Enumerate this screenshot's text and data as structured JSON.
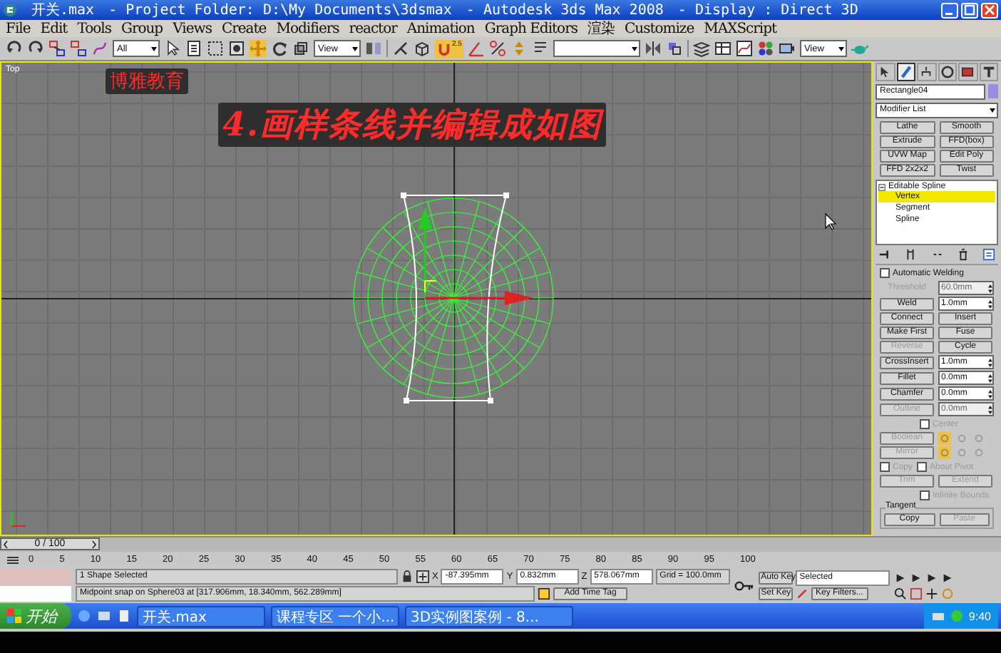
{
  "window": {
    "title_parts": [
      "开关.max",
      "- Project Folder: D:\\My Documents\\3dsmax",
      "- Autodesk 3ds Max 2008",
      "- Display : Direct 3D"
    ]
  },
  "menu": [
    "File",
    "Edit",
    "Tools",
    "Group",
    "Views",
    "Create",
    "Modifiers",
    "reactor",
    "Animation",
    "Graph Editors",
    "渲染",
    "Customize",
    "MAXScript"
  ],
  "toolbar": {
    "selection_filter": "All",
    "coord_system": "View",
    "snap_label": "2.5",
    "render_view": "View"
  },
  "viewport": {
    "label": "Top",
    "brand_caption": "博雅教育",
    "step_title": "4.画样条线并编辑成如图"
  },
  "command_panel": {
    "tabs": [
      {
        "selected": false
      },
      {
        "selected": true
      },
      {
        "selected": false
      },
      {
        "selected": false
      },
      {
        "selected": false
      },
      {
        "selected": false
      }
    ],
    "object_name": "Rectangle04",
    "modifier_list": "Modifier List",
    "modifier_buttons": [
      "Lathe",
      "Smooth",
      "Extrude",
      "FFD(box)",
      "UVW Map",
      "Edit Poly",
      "FFD 2x2x2",
      "Twist"
    ],
    "stack": [
      {
        "label": "Editable Spline",
        "expanded": true,
        "children": [
          {
            "label": "Vertex",
            "selected": true
          },
          {
            "label": "Segment",
            "selected": false
          },
          {
            "label": "Spline",
            "selected": false
          }
        ]
      }
    ],
    "rollout": [
      {
        "kind": "check",
        "label": "Automatic Welding",
        "checked": false,
        "disabled": false
      },
      {
        "kind": "spinner",
        "label": "Threshold",
        "value": "60.0mm",
        "button": false,
        "disabled": true
      },
      {
        "kind": "spinner",
        "label": "Weld",
        "value": "1.0mm",
        "button": true,
        "disabled": false
      },
      {
        "kind": "pair",
        "buttons": [
          {
            "label": "Connect",
            "disabled": false
          },
          {
            "label": "Insert",
            "disabled": false
          }
        ]
      },
      {
        "kind": "pair",
        "buttons": [
          {
            "label": "Make First",
            "disabled": false
          },
          {
            "label": "Fuse",
            "disabled": false
          }
        ]
      },
      {
        "kind": "pair",
        "buttons": [
          {
            "label": "Reverse",
            "disabled": true
          },
          {
            "label": "Cycle",
            "disabled": false
          }
        ]
      },
      {
        "kind": "spinner",
        "label": "CrossInsert",
        "value": "1.0mm",
        "button": true,
        "disabled": false
      },
      {
        "kind": "spinner",
        "label": "Fillet",
        "value": "0.0mm",
        "button": true,
        "disabled": false
      },
      {
        "kind": "spinner",
        "label": "Chamfer",
        "value": "0.0mm",
        "button": true,
        "disabled": false
      },
      {
        "kind": "spinner",
        "label": "Outline",
        "value": "0.0mm",
        "button": true,
        "disabled": true
      },
      {
        "kind": "check",
        "label": "Center",
        "checked": false,
        "disabled": true
      },
      {
        "kind": "tool",
        "label": "Boolean",
        "disabled": true
      },
      {
        "kind": "tool",
        "label": "Mirror",
        "disabled": true
      },
      {
        "kind": "checks",
        "checks": [
          {
            "label": "Copy",
            "checked": false,
            "disabled": true
          },
          {
            "label": "About Pivot",
            "checked": false,
            "disabled": true
          }
        ]
      },
      {
        "kind": "pair",
        "buttons": [
          {
            "label": "Trim",
            "disabled": true
          },
          {
            "label": "Extend",
            "disabled": true
          }
        ]
      },
      {
        "kind": "check",
        "label": "Infinite Bounds",
        "checked": false,
        "disabled": true
      },
      {
        "kind": "group",
        "title": "Tangent",
        "buttons": [
          {
            "label": "Copy",
            "disabled": false
          },
          {
            "label": "Paste",
            "disabled": true
          }
        ]
      }
    ]
  },
  "time_slider": {
    "position": "0 / 100",
    "level": 0
  },
  "ruler": [
    "0",
    "5",
    "10",
    "15",
    "20",
    "25",
    "30",
    "35",
    "40",
    "45",
    "50",
    "55",
    "60",
    "65",
    "70",
    "75",
    "80",
    "85",
    "90",
    "95",
    "100"
  ],
  "status": {
    "selection": "1 Shape Selected",
    "prompt": "Midpoint snap on Sphere03 at [317.906mm, 18.340mm, 562.289mm]",
    "x_label": "X",
    "y_label": "Y",
    "z_label": "Z",
    "x": "-87.395mm",
    "y": "0.832mm",
    "z": "578.067mm",
    "grid": "Grid = 100.0mm",
    "add_time_tag": "Add Time Tag",
    "auto_key": "Auto Key",
    "key_mode": "Selected",
    "set_key": "Set Key",
    "key_filters": "Key Filters..."
  },
  "taskbar": {
    "start": "开始",
    "tasks": [
      "开关.max",
      "课程专区 一个小...",
      "3D实例图案例 - 8..."
    ],
    "clock": "9:40"
  }
}
